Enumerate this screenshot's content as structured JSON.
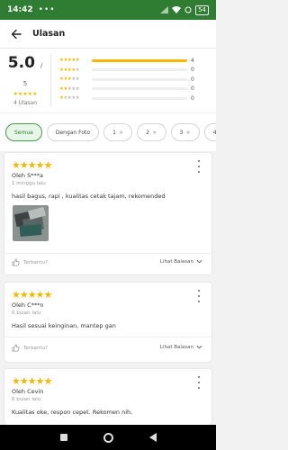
{
  "status_bar": {
    "time": "14:42",
    "dots": "•••",
    "battery": "54"
  },
  "header": {
    "title": "Ulasan"
  },
  "summary": {
    "score": "5.0",
    "max": "/ 5",
    "stars": "★★★★★",
    "count": "4 Ulasan",
    "distribution": [
      {
        "stars": 5,
        "fraction": 1.0,
        "count": "4"
      },
      {
        "stars": 4,
        "fraction": 0,
        "count": "0"
      },
      {
        "stars": 3,
        "fraction": 0,
        "count": "0"
      },
      {
        "stars": 2,
        "fraction": 0,
        "count": "0"
      },
      {
        "stars": 1,
        "fraction": 0,
        "count": "0"
      }
    ]
  },
  "filters": [
    {
      "label": "Semua",
      "active": true,
      "star": ""
    },
    {
      "label": "Dengan Foto",
      "active": false,
      "star": ""
    },
    {
      "label": "1",
      "active": false,
      "star": "★"
    },
    {
      "label": "2",
      "active": false,
      "star": "★"
    },
    {
      "label": "3",
      "active": false,
      "star": "★"
    },
    {
      "label": "4",
      "active": false,
      "star": ""
    }
  ],
  "reviews": [
    {
      "stars": "★★★★★",
      "author": "Oleh S***a",
      "time": "1 minggu lalu",
      "text": "hasil bagus, rapi , kualitas cetak tajam, rekomended",
      "has_photo": true,
      "helpful": "Terbantu?",
      "reply": "Lihat Balasan"
    },
    {
      "stars": "★★★★★",
      "author": "Oleh C***n",
      "time": "6 bulan lalu",
      "text": "Hasil sesuai keinginan, mantep gan",
      "has_photo": false,
      "helpful": "Terbantu?",
      "reply": "Lihat Balasan"
    },
    {
      "stars": "★★★★★",
      "author": "Oleh Cevin",
      "time": "6 bulan lalu",
      "text": "Kualitas oke, respon cepet. Rekomen nih.",
      "has_photo": false,
      "helpful": "",
      "reply": ""
    }
  ],
  "colors": {
    "accent": "#2e7d32",
    "star": "#f5b800",
    "chip_active_bg": "#e8f5e9"
  }
}
